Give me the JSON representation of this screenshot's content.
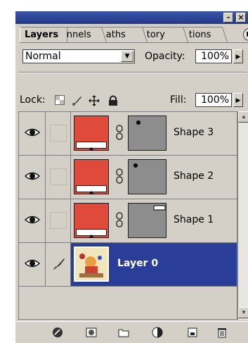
{
  "tabs": [
    {
      "label": "Layers"
    },
    {
      "label": "nnels"
    },
    {
      "label": "aths"
    },
    {
      "label": "tory"
    },
    {
      "label": "tions"
    }
  ],
  "blend_mode": {
    "value": "Normal"
  },
  "opacity": {
    "label": "Opacity:",
    "value": "100%"
  },
  "lock": {
    "label": "Lock:"
  },
  "fill": {
    "label": "Fill:",
    "value": "100%"
  },
  "layers": [
    {
      "name": "Shape 3",
      "fill_color": "#e04a3a",
      "visible": true
    },
    {
      "name": "Shape 2",
      "fill_color": "#e04a3a",
      "visible": true
    },
    {
      "name": "Shape 1",
      "fill_color": "#e04a3a",
      "visible": true
    },
    {
      "name": "Layer 0",
      "visible": true,
      "selected": true
    }
  ],
  "colors": {
    "selection": "#2a3d99",
    "titlebar": "#24398a",
    "panel": "#d4d0c8"
  },
  "icons": [
    "eye-icon",
    "brush-icon",
    "link-icon",
    "layer-style-icon",
    "mask-icon",
    "new-set-icon",
    "adjustment-layer-icon",
    "new-layer-icon",
    "trash-icon"
  ]
}
